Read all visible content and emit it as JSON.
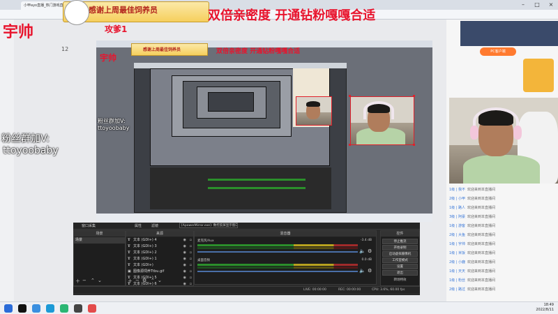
{
  "browser": {
    "tab_title": "小甲ayo直播_热门游戏直播_斗鱼",
    "address": "douyu.com"
  },
  "overlay": {
    "corner_name": "宇帅",
    "fan_group_label": "粉丝群加V:",
    "fan_group_id": "ttoyoobaby",
    "banner_text": "感谢上周最佳饲养员",
    "banner_sub": "攻爹1",
    "headline": "双倍亲密度 开通钻粉嘎嘎合适"
  },
  "obs": {
    "scene_tab": "窗口采集",
    "props_btn": "属性",
    "filters_btn": "滤镜",
    "window_field": "[ApowerMirror.exe]: 数控反屏显示窗口",
    "panels": {
      "scenes": "场景",
      "sources": "来源",
      "mixer": "混音器",
      "controls": "控件"
    },
    "scene_items": [
      "场景"
    ],
    "sources": [
      {
        "icon": "T",
        "label": "文本 (GDI+) 4"
      },
      {
        "icon": "T",
        "label": "文本 (GDI+) 3"
      },
      {
        "icon": "T",
        "label": "文本 (GDI+) 2"
      },
      {
        "icon": "T",
        "label": "文本 (GDI+) 1"
      },
      {
        "icon": "T",
        "label": "文本 (GDI+)"
      },
      {
        "icon": "img",
        "label": "图像源饲养Ttbu.gif"
      },
      {
        "icon": "T",
        "label": "文本 (GDI+) 5"
      },
      {
        "icon": "T",
        "label": "文本 (GDI+) 6"
      }
    ],
    "mixer_tracks": [
      {
        "name": "麦克风/Aux",
        "db": "-3.4 dB"
      },
      {
        "name": "桌面音频",
        "db": "0.0 dB"
      }
    ],
    "controls": [
      "停止推流",
      "开始录制",
      "启动虚拟摄像机",
      "工作室模式",
      "设置",
      "退出"
    ],
    "transition_label": "转场特效",
    "transition_value": "淡入",
    "status": {
      "dropped": "丢帧 0 (0.0%)",
      "live": "LIVE: 00:00:00",
      "rec": "REC: 00:00:00",
      "cpu": "CPU: 3.6%, 60.00 fps"
    }
  },
  "chat": [
    {
      "user": "1级 | 我不",
      "msg": "欢迎来到本直播间"
    },
    {
      "user": "2级 | 小甲",
      "msg": "欢迎来到本直播间"
    },
    {
      "user": "1级 | 路人",
      "msg": "欢迎来到本直播间"
    },
    {
      "user": "3级 | 阿豪",
      "msg": "欢迎来到本直播间"
    },
    {
      "user": "1级 | 游客",
      "msg": "欢迎来到本直播间"
    },
    {
      "user": "2级 | 大鱼",
      "msg": "欢迎来到本直播间"
    },
    {
      "user": "1级 | 宇帅",
      "msg": "欢迎来到本直播间"
    },
    {
      "user": "1级 | 米饭",
      "msg": "欢迎来到本直播间"
    },
    {
      "user": "2级 | 小鹿",
      "msg": "欢迎来到本直播间"
    },
    {
      "user": "1级 | 天天",
      "msg": "欢迎来到本直播间"
    },
    {
      "user": "1级 | 粉丝",
      "msg": "欢迎来到本直播间"
    },
    {
      "user": "2级 | 路过",
      "msg": "欢迎来到本直播间"
    }
  ],
  "right_panel": {
    "pc_button": "PC客户端",
    "rank_label": "12"
  },
  "taskbar": {
    "time": "18:49",
    "date": "2022/8/11"
  }
}
